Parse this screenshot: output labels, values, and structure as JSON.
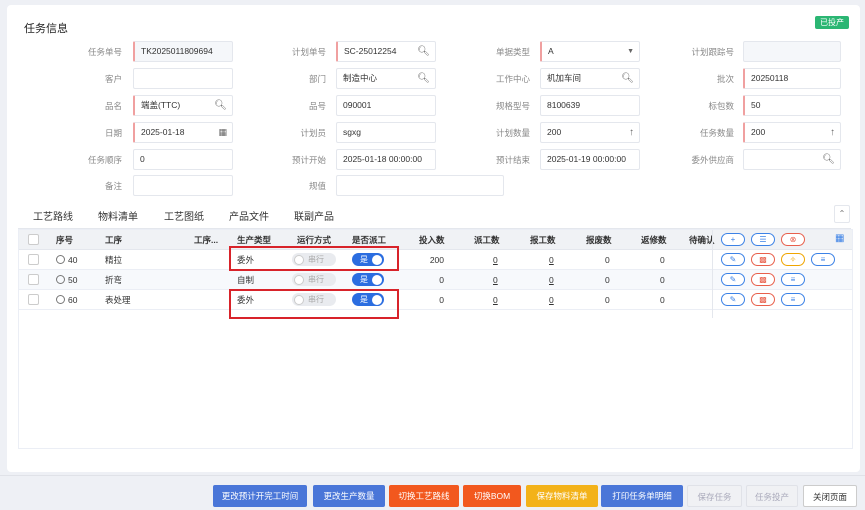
{
  "header": {
    "title": "任务信息",
    "status_badge": "已投产"
  },
  "form": {
    "task_no": {
      "label": "任务单号",
      "value": "TK2025011809694"
    },
    "plan_no": {
      "label": "计划单号",
      "value": "SC-25012254"
    },
    "doc_type": {
      "label": "单据类型",
      "value": "A"
    },
    "plan_track_no": {
      "label": "计划跟踪号",
      "value": ""
    },
    "customer": {
      "label": "客户",
      "value": ""
    },
    "department": {
      "label": "部门",
      "value": "制造中心"
    },
    "work_center": {
      "label": "工作中心",
      "value": "机加车间"
    },
    "batch": {
      "label": "批次",
      "value": "20250118"
    },
    "product_name": {
      "label": "品名",
      "value": "端盖(TTC)"
    },
    "product_no": {
      "label": "品号",
      "value": "090001"
    },
    "spec_model": {
      "label": "规格型号",
      "value": "8100639"
    },
    "pack_qty": {
      "label": "标包数",
      "value": "50"
    },
    "date": {
      "label": "日期",
      "value": "2025-01-18"
    },
    "planner": {
      "label": "计划员",
      "value": "sgxg"
    },
    "plan_qty": {
      "label": "计划数量",
      "value": "200"
    },
    "task_qty": {
      "label": "任务数量",
      "value": "200"
    },
    "task_seq": {
      "label": "任务顺序",
      "value": "0"
    },
    "plan_start": {
      "label": "预计开始",
      "value": "2025-01-18 00:00:00"
    },
    "plan_end": {
      "label": "预计结束",
      "value": "2025-01-19 00:00:00"
    },
    "outsource_supplier": {
      "label": "委外供应商",
      "value": ""
    },
    "remark": {
      "label": "备注",
      "value": ""
    },
    "spec_value": {
      "label": "规值",
      "value": ""
    }
  },
  "tabs": [
    "工艺路线",
    "物料清单",
    "工艺图纸",
    "产品文件",
    "联副产品"
  ],
  "table": {
    "headers": {
      "seq": "序号",
      "process": "工序",
      "process_desc": "工序...",
      "prod_type": "生产类型",
      "run_mode": "运行方式",
      "dispatch": "是否派工",
      "input_qty": "投入数",
      "dispatch_qty": "派工数",
      "report_qty": "报工数",
      "scrap_qty": "报废数",
      "rework_qty": "返修数",
      "pending": "待确认"
    },
    "rows": [
      {
        "seq": "40",
        "process": "精拉",
        "prod_type": "委外",
        "run_mode": "串行",
        "dispatch": "是",
        "input_qty": "200",
        "dispatch_qty": "0",
        "report_qty": "0",
        "scrap_qty": "0",
        "rework_qty": "0"
      },
      {
        "seq": "50",
        "process": "折弯",
        "prod_type": "自制",
        "run_mode": "串行",
        "dispatch": "是",
        "input_qty": "0",
        "dispatch_qty": "0",
        "report_qty": "0",
        "scrap_qty": "0",
        "rework_qty": "0"
      },
      {
        "seq": "60",
        "process": "表处理",
        "prod_type": "委外",
        "run_mode": "串行",
        "dispatch": "是",
        "input_qty": "0",
        "dispatch_qty": "0",
        "report_qty": "0",
        "scrap_qty": "0",
        "rework_qty": "0"
      }
    ]
  },
  "buttons": {
    "change_time": "更改预计开完工时间",
    "change_qty": "更改生产数量",
    "switch_route": "切换工艺路线",
    "switch_bom": "切换BOM",
    "save_materials": "保存物料清单",
    "print_detail": "打印任务单明细",
    "save_task": "保存任务",
    "task_release": "任务投产",
    "close_page": "关闭页面"
  },
  "colors": {
    "primary": "#4a76d8",
    "danger": "#f2581e",
    "warning": "#f3b219",
    "success": "#2bb673",
    "highlight": "#d8232a"
  }
}
